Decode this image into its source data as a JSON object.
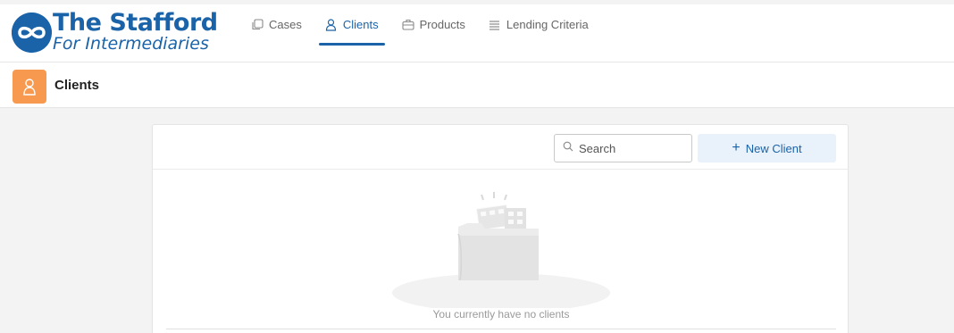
{
  "brand": {
    "name": "The Stafford",
    "tagline": "For Intermediaries",
    "color": "#1b63a8"
  },
  "nav": {
    "items": [
      {
        "label": "Cases",
        "icon": "cases-icon",
        "active": false
      },
      {
        "label": "Clients",
        "icon": "user-icon",
        "active": true
      },
      {
        "label": "Products",
        "icon": "briefcase-icon",
        "active": false
      },
      {
        "label": "Lending Criteria",
        "icon": "list-icon",
        "active": false
      }
    ]
  },
  "page": {
    "title": "Clients",
    "icon": "user-icon",
    "icon_color": "#f7994f"
  },
  "toolbar": {
    "search_placeholder": "Search",
    "new_client_label": "New Client"
  },
  "empty_state": {
    "message": "You currently have no clients"
  }
}
